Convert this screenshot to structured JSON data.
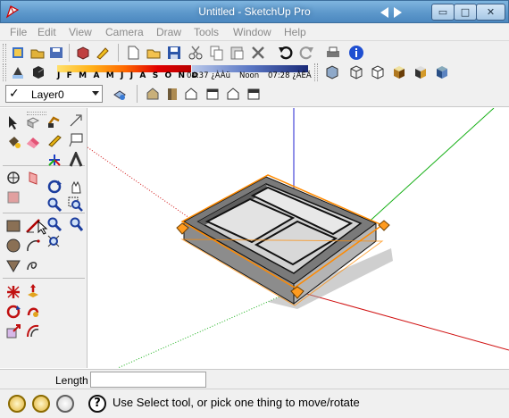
{
  "window": {
    "title": "Untitled - SketchUp Pro",
    "min_glyph": "▭",
    "max_glyph": "□",
    "close_glyph": "✕"
  },
  "menu": [
    "File",
    "Edit",
    "View",
    "Camera",
    "Draw",
    "Tools",
    "Window",
    "Help"
  ],
  "shadow_toolbar": {
    "months_label": "J F M A M J J A S O N D",
    "time_start": "04:37 ¿ÀÀü",
    "time_noon": "Noon",
    "time_end": "07:28 ¿ÀÈÄ"
  },
  "layer": {
    "current": "Layer0",
    "check_glyph": "✓"
  },
  "measurements": {
    "label": "Length",
    "value": ""
  },
  "status": {
    "message": "Use Select tool, or pick one thing to move/rotate",
    "help_glyph": "?"
  },
  "colors": {
    "axis_red": "#d01010",
    "axis_green": "#18b018",
    "axis_blue": "#2020d0",
    "selection": "#ff8a00",
    "titlebar": "#5d98cb"
  },
  "icons": {
    "toolbar_row1": [
      "new-icon",
      "open-icon",
      "save-icon",
      "make-component-icon",
      "paint-icon",
      "new-file-icon",
      "open-file-icon",
      "save-file-icon",
      "cut-icon",
      "copy-icon",
      "paste-icon",
      "erase-icon",
      "undo-icon",
      "redo-icon",
      "print-icon",
      "model-info-icon"
    ],
    "toolbar_row2": [
      "shadow-settings-icon",
      "display-shadows-icon",
      "xray-icon",
      "wireframe-icon",
      "hidden-line-icon",
      "shaded-icon",
      "shaded-textures-icon",
      "monochrome-icon"
    ],
    "toolbar_row3": [
      "layer-manager-icon",
      "iso-view-icon",
      "top-view-icon",
      "front-view-icon",
      "right-view-icon",
      "back-view-icon",
      "left-view-icon"
    ]
  }
}
